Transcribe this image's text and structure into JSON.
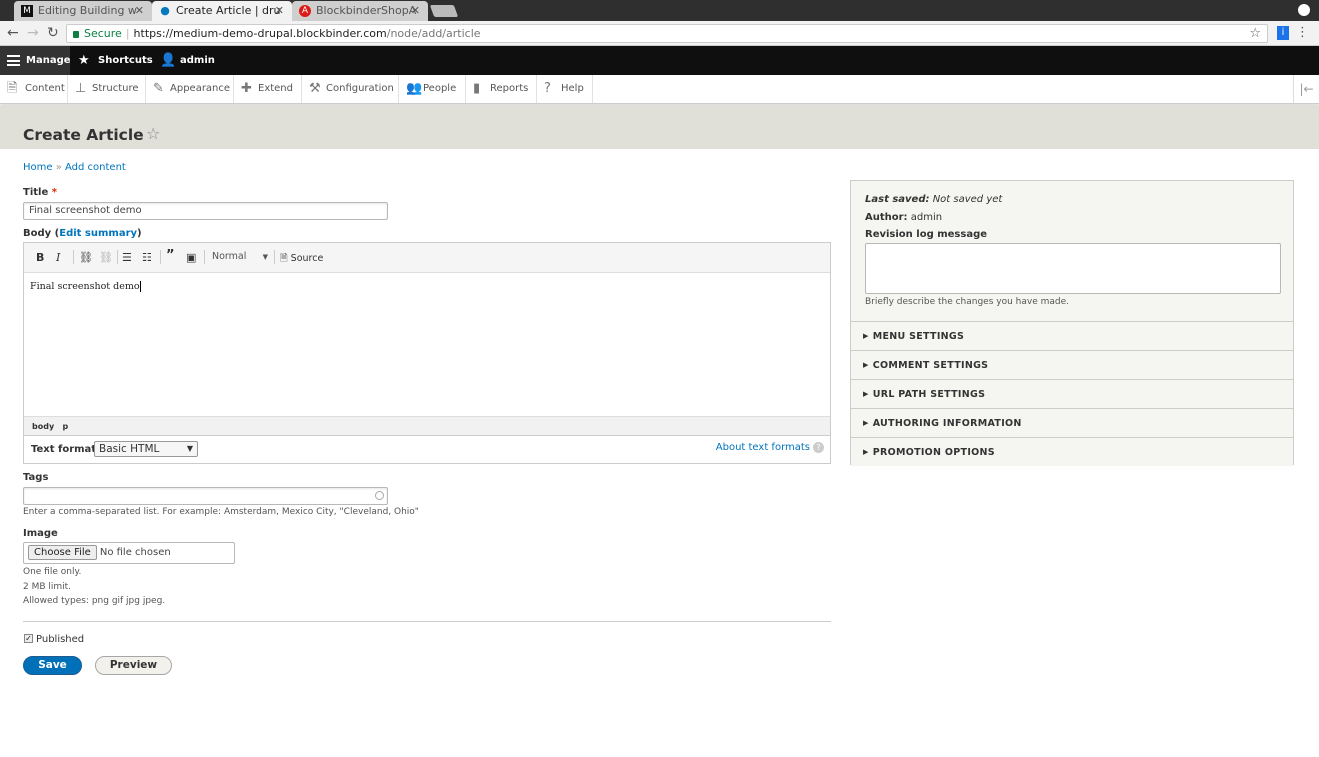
{
  "browser": {
    "tabs": [
      {
        "title": "Editing Building w",
        "favicon": "M",
        "active": false
      },
      {
        "title": "Create Article | dru",
        "favicon": "drupal",
        "active": true
      },
      {
        "title": "BlockbinderShopA",
        "favicon": "A",
        "active": false
      }
    ],
    "secure_label": "Secure",
    "url_scheme_host": "https://medium-demo-drupal.blockbinder.com",
    "url_path": "/node/add/article"
  },
  "toolbar": {
    "manage": "Manage",
    "shortcuts": "Shortcuts",
    "user": "admin"
  },
  "tray": {
    "items": [
      "Content",
      "Structure",
      "Appearance",
      "Extend",
      "Configuration",
      "People",
      "Reports",
      "Help"
    ]
  },
  "page": {
    "title": "Create Article",
    "breadcrumb_home": "Home",
    "breadcrumb_sep": " » ",
    "breadcrumb_current": "Add content"
  },
  "form": {
    "title_label": "Title",
    "title_required": "*",
    "title_value": "Final screenshot demo",
    "body_label": "Body (",
    "body_edit_summary": "Edit summary",
    "body_label_close": ")",
    "editor_format_dropdown": "Normal",
    "editor_source": "Source",
    "body_value": "Final screenshot demo",
    "element_path": [
      "body",
      "p"
    ],
    "text_format_label": "Text format",
    "text_format_value": "Basic HTML",
    "about_text_formats": "About text formats",
    "tags_label": "Tags",
    "tags_value": "",
    "tags_help": "Enter a comma-separated list. For example: Amsterdam, Mexico City, \"Cleveland, Ohio\"",
    "image_label": "Image",
    "choose_file": "Choose File",
    "no_file": "No file chosen",
    "image_help": [
      "One file only.",
      "2 MB limit.",
      "Allowed types: png gif jpg jpeg."
    ],
    "published_label": "Published",
    "published_checked": true,
    "save": "Save",
    "preview": "Preview"
  },
  "sidebar": {
    "last_saved_label": "Last saved:",
    "last_saved_value": "Not saved yet",
    "author_label": "Author:",
    "author_value": "admin",
    "revision_label": "Revision log message",
    "revision_help": "Briefly describe the changes you have made.",
    "sections": [
      "MENU SETTINGS",
      "COMMENT SETTINGS",
      "URL PATH SETTINGS",
      "AUTHORING INFORMATION",
      "PROMOTION OPTIONS"
    ]
  }
}
